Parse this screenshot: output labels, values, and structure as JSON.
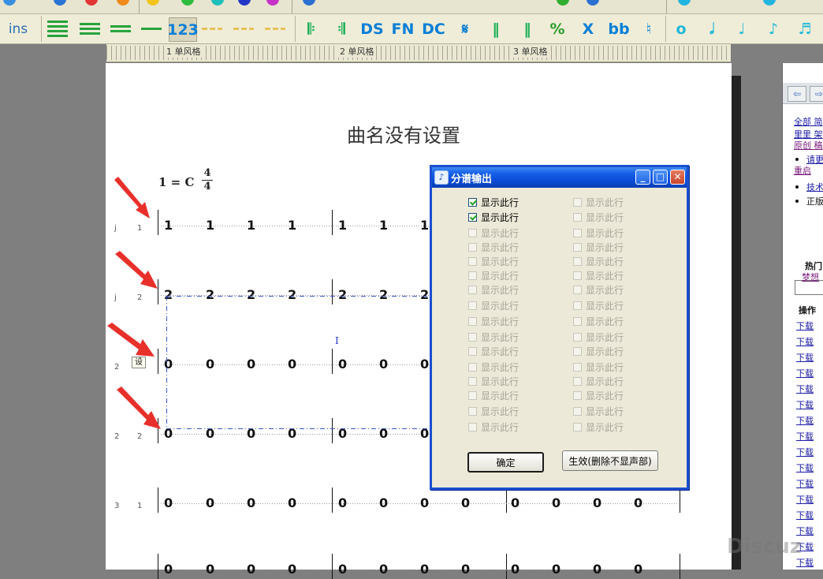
{
  "toolbar": {
    "ins_label": "ins",
    "num_label": "123",
    "ds_label": "DS",
    "fn_label": "FN",
    "dc_label": "DC",
    "x_label": "X",
    "flatflat_label": "bb"
  },
  "ruler": {
    "labels": [
      "1 单风格",
      "2 单风格",
      "3 单风格"
    ]
  },
  "score": {
    "title": "曲名没有设置",
    "key": "1 = C",
    "time_top": "4",
    "time_bottom": "4",
    "row_labels": [
      [
        "j",
        "1"
      ],
      [
        "j",
        "2"
      ],
      [
        "2",
        ""
      ],
      [
        "2",
        "2"
      ],
      [
        "3",
        "1"
      ]
    ],
    "rows": [
      [
        "1",
        "1",
        "1",
        "1",
        "1",
        "1",
        "1"
      ],
      [
        "2",
        "2",
        "2",
        "2",
        "2",
        "2",
        "2"
      ],
      [
        "0",
        "0",
        "0",
        "0",
        "0",
        "0",
        "0"
      ],
      [
        "0",
        "0",
        "0",
        "0",
        "0",
        "0",
        "0"
      ],
      [
        "0",
        "0",
        "0",
        "0",
        "0",
        "0",
        "0",
        "0",
        "0",
        "0",
        "0",
        "0"
      ],
      [
        "0",
        "0",
        "0",
        "0",
        "0",
        "0",
        "0",
        "0",
        "0",
        "0",
        "0",
        "0"
      ]
    ],
    "tooltip_char": "设",
    "cursor_char": "I"
  },
  "dialog": {
    "title": "分谱输出",
    "checkbox_label": "显示此行",
    "left_column": [
      {
        "checked": true,
        "enabled": true
      },
      {
        "checked": true,
        "enabled": true
      },
      {
        "checked": false,
        "enabled": false
      },
      {
        "checked": false,
        "enabled": false
      },
      {
        "checked": false,
        "enabled": false
      },
      {
        "checked": false,
        "enabled": false
      },
      {
        "checked": false,
        "enabled": false
      },
      {
        "checked": false,
        "enabled": false
      },
      {
        "checked": false,
        "enabled": false
      },
      {
        "checked": false,
        "enabled": false
      },
      {
        "checked": false,
        "enabled": false
      },
      {
        "checked": false,
        "enabled": false
      },
      {
        "checked": false,
        "enabled": false
      },
      {
        "checked": false,
        "enabled": false
      },
      {
        "checked": false,
        "enabled": false
      },
      {
        "checked": false,
        "enabled": false
      }
    ],
    "right_column_count": 16,
    "ok_label": "确定",
    "apply_label": "生效(删除不显声部)"
  },
  "browser_panel": {
    "links_top": [
      "全部 简",
      "里里 架",
      "原创 稿"
    ],
    "bullet1": "请更",
    "restart": "重启",
    "bullet2": "技术",
    "bullet3": "正版",
    "hot_label": "热门",
    "hot_link": "梦想",
    "ops_label": "操作",
    "download_label": "下载",
    "download_count": 16
  },
  "watermark": "Discuz"
}
